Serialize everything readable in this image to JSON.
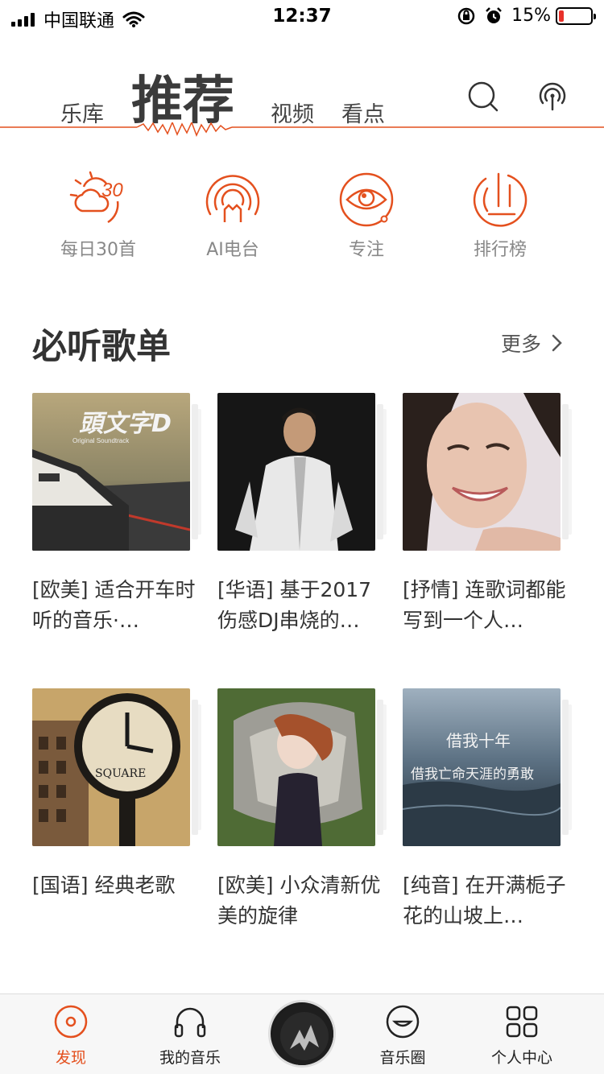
{
  "status_bar": {
    "carrier": "中国联通",
    "time": "12:37",
    "battery": "15%"
  },
  "top_nav": {
    "tabs": [
      {
        "label": "乐库"
      },
      {
        "label": "推荐"
      },
      {
        "label": "视频"
      },
      {
        "label": "看点"
      }
    ],
    "accent_color": "#e4501e"
  },
  "quick_entries": [
    {
      "label": "每日30首",
      "icon": "daily-30-icon"
    },
    {
      "label": "AI电台",
      "icon": "ai-radio-icon"
    },
    {
      "label": "专注",
      "icon": "focus-eye-icon"
    },
    {
      "label": "排行榜",
      "icon": "chart-rank-icon"
    }
  ],
  "section": {
    "title": "必听歌单",
    "more_label": "更多"
  },
  "playlists": [
    {
      "title": "[欧美] 适合开车时听的音乐·…"
    },
    {
      "title": "[华语] 基于2017伤感DJ串烧的…"
    },
    {
      "title": "[抒情] 连歌词都能写到一个人…"
    },
    {
      "title": "[国语] 经典老歌"
    },
    {
      "title": "[欧美] 小众清新优美的旋律"
    },
    {
      "title": "[纯音] 在开满栀子花的山坡上…"
    }
  ],
  "cover_texts": {
    "initial_d": "頭文字D",
    "initial_d_sub": "Original Soundtrack",
    "clock_word": "SQUARE",
    "sea_line1": "借我十年",
    "sea_line2": "借我亡命天涯的勇敢"
  },
  "tabbar": [
    {
      "label": "发现",
      "active": true
    },
    {
      "label": "我的音乐"
    },
    {
      "label": "音乐圈"
    },
    {
      "label": "个人中心"
    }
  ]
}
